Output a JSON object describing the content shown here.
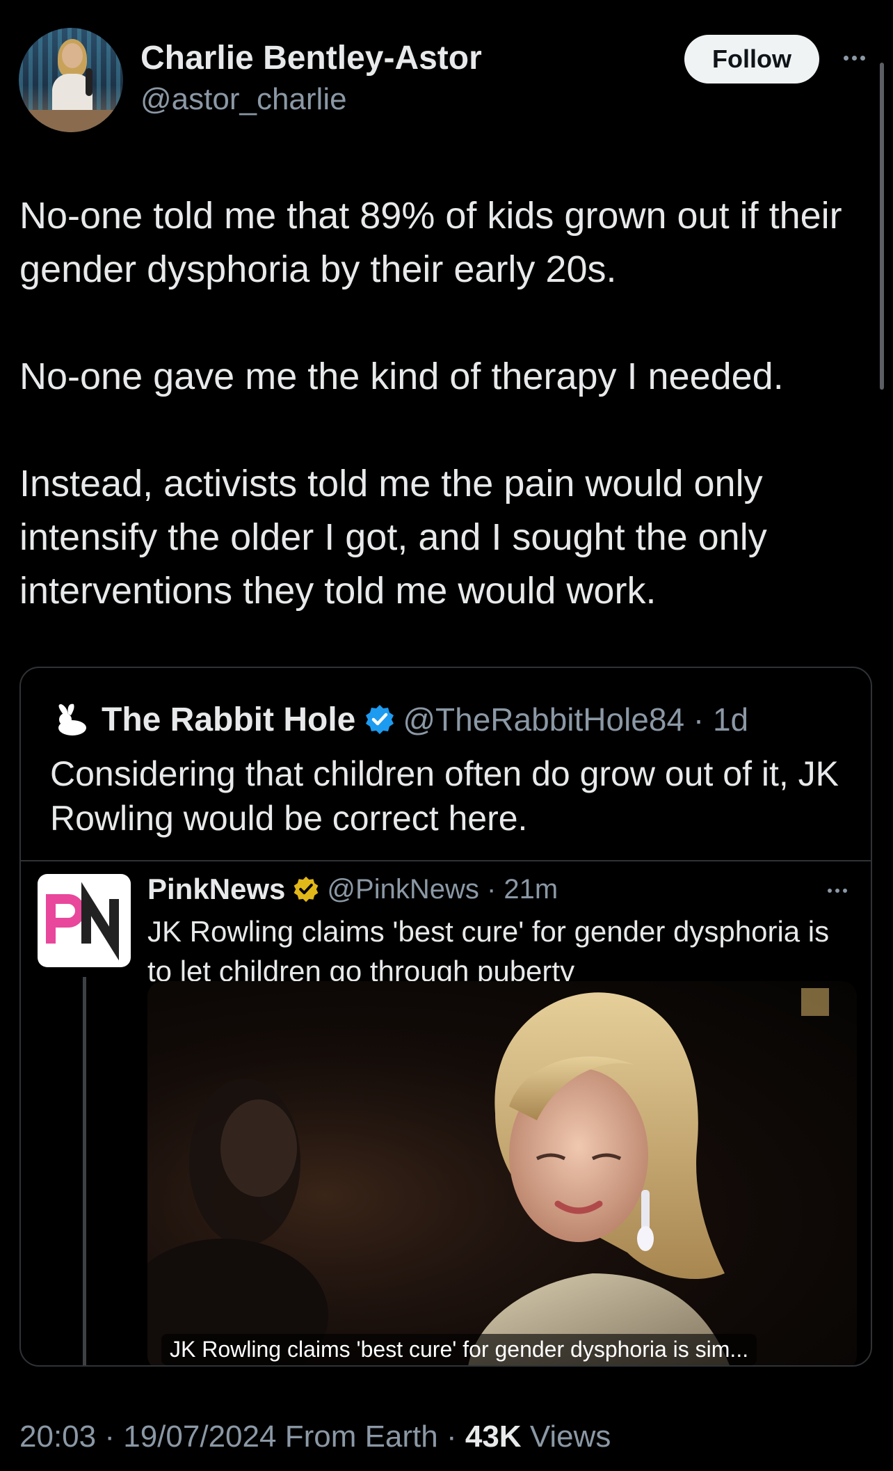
{
  "tweet": {
    "author_name": "Charlie Bentley-Astor",
    "author_handle": "@astor_charlie",
    "follow_label": "Follow",
    "paragraphs": [
      "No-one told me that 89% of kids grown out if their gender dysphoria by their early 20s.",
      "No-one gave me the kind of therapy I needed.",
      "Instead, activists told me the pain would only intensify the older I got, and I sought the only interventions they told me would work."
    ],
    "time": "20:03",
    "date": "19/07/2024",
    "source": "From Earth",
    "views_count": "43K",
    "views_label": "Views"
  },
  "quote": {
    "name": "The Rabbit Hole",
    "handle": "@TheRabbitHole84",
    "age": "1d",
    "text": "Considering that children often do grow out of it, JK Rowling would be correct here."
  },
  "nested_quote": {
    "name": "PinkNews",
    "handle": "@PinkNews",
    "age": "21m",
    "logo_text": "PN",
    "text": "JK Rowling claims 'best cure' for gender dysphoria is to let children go through puberty",
    "media_caption": "JK Rowling claims 'best cure' for gender dysphoria is sim..."
  },
  "icons": {
    "more": "more-horizontal-icon",
    "verified": "blue-verified-badge-icon",
    "gold_verified": "gold-verified-badge-icon",
    "rabbit": "rabbit-icon"
  },
  "colors": {
    "background": "#000000",
    "text": "#e7e9ea",
    "secondary": "#8b98a5",
    "verified_blue": "#1d9bf0",
    "verified_gold": "#e2b719",
    "pinknews_pink": "#e8479b",
    "border": "#2f3336"
  }
}
